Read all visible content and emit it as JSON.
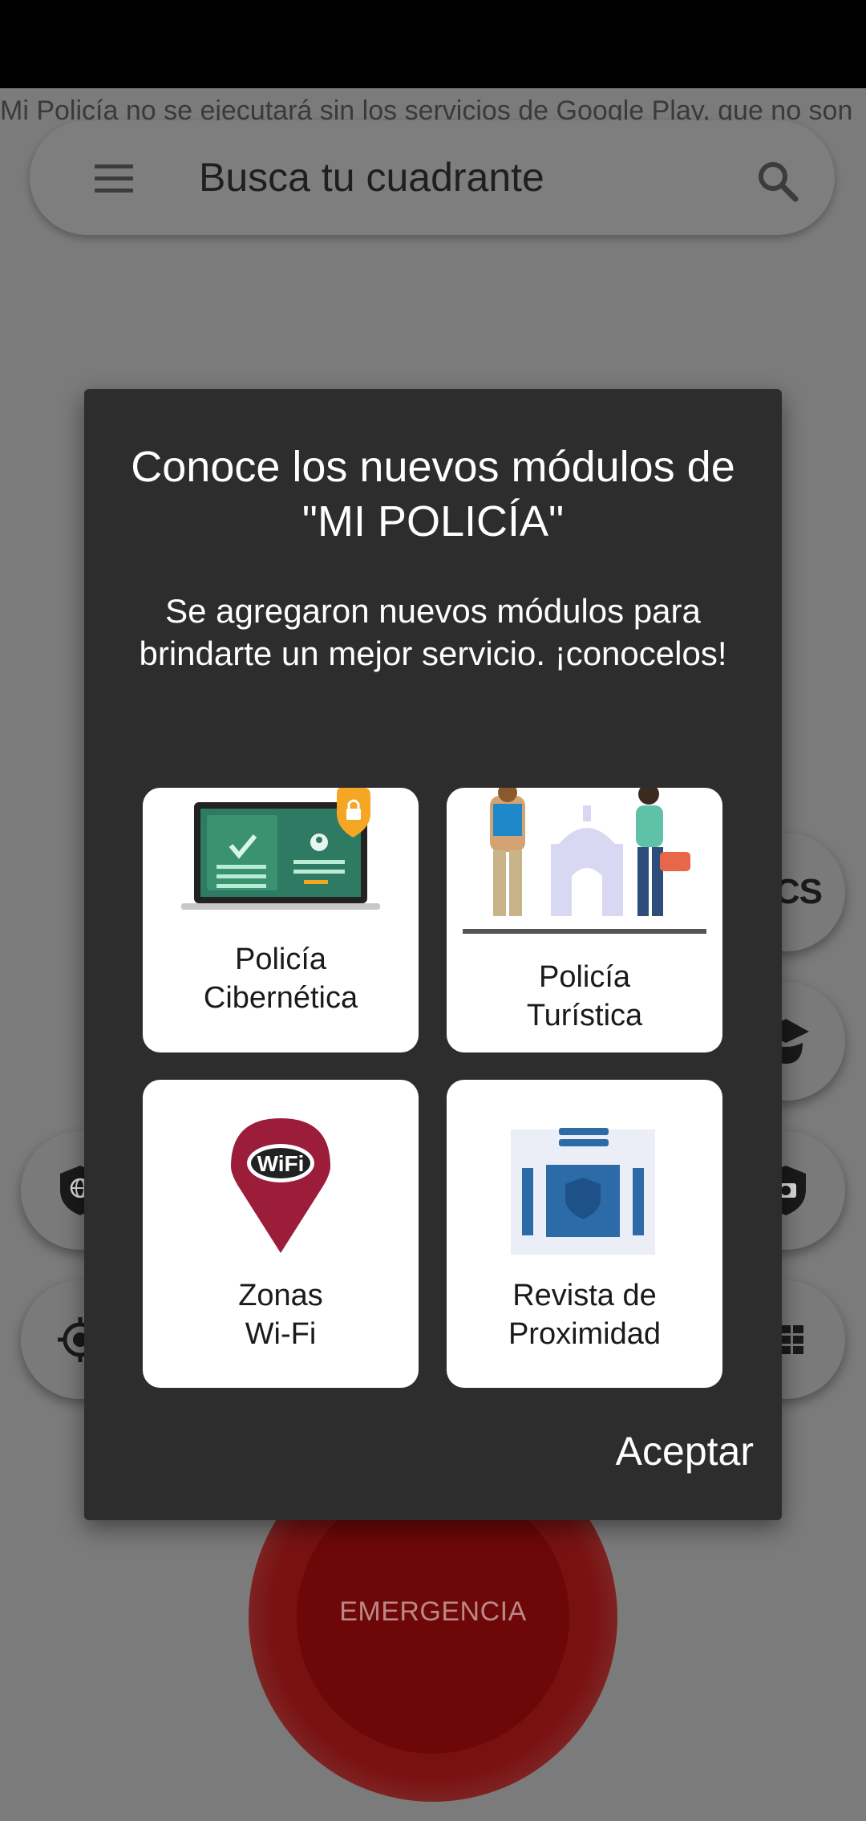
{
  "warning": "Mi Policía no se ejecutará sin los servicios de Google Play, que no son",
  "search": {
    "placeholder": "Busca tu cuadrante"
  },
  "fabs": {
    "ucs_label": "UCS"
  },
  "emergency": {
    "label": "EMERGENCIA"
  },
  "dialog": {
    "title": "Conoce los nuevos módulos de \"MI POLICÍA\"",
    "subtitle": "Se agregaron nuevos módulos para brindarte un mejor servicio. ¡conocelos!",
    "cards": [
      {
        "line1": "Policía",
        "line2": "Cibernética"
      },
      {
        "line1": "Policía",
        "line2": "Turística"
      },
      {
        "line1": "Zonas",
        "line2": "Wi-Fi",
        "icon_text": "WiFi"
      },
      {
        "line1": "Revista de",
        "line2": "Proximidad"
      }
    ],
    "accept_label": "Aceptar"
  },
  "colors": {
    "emergency_red": "#6e0707",
    "dialog_bg": "#2d2d2d",
    "wifi_pin": "#9b1d3a",
    "accent_orange": "#f5a623",
    "magazine_blue": "#2d6aa8"
  }
}
